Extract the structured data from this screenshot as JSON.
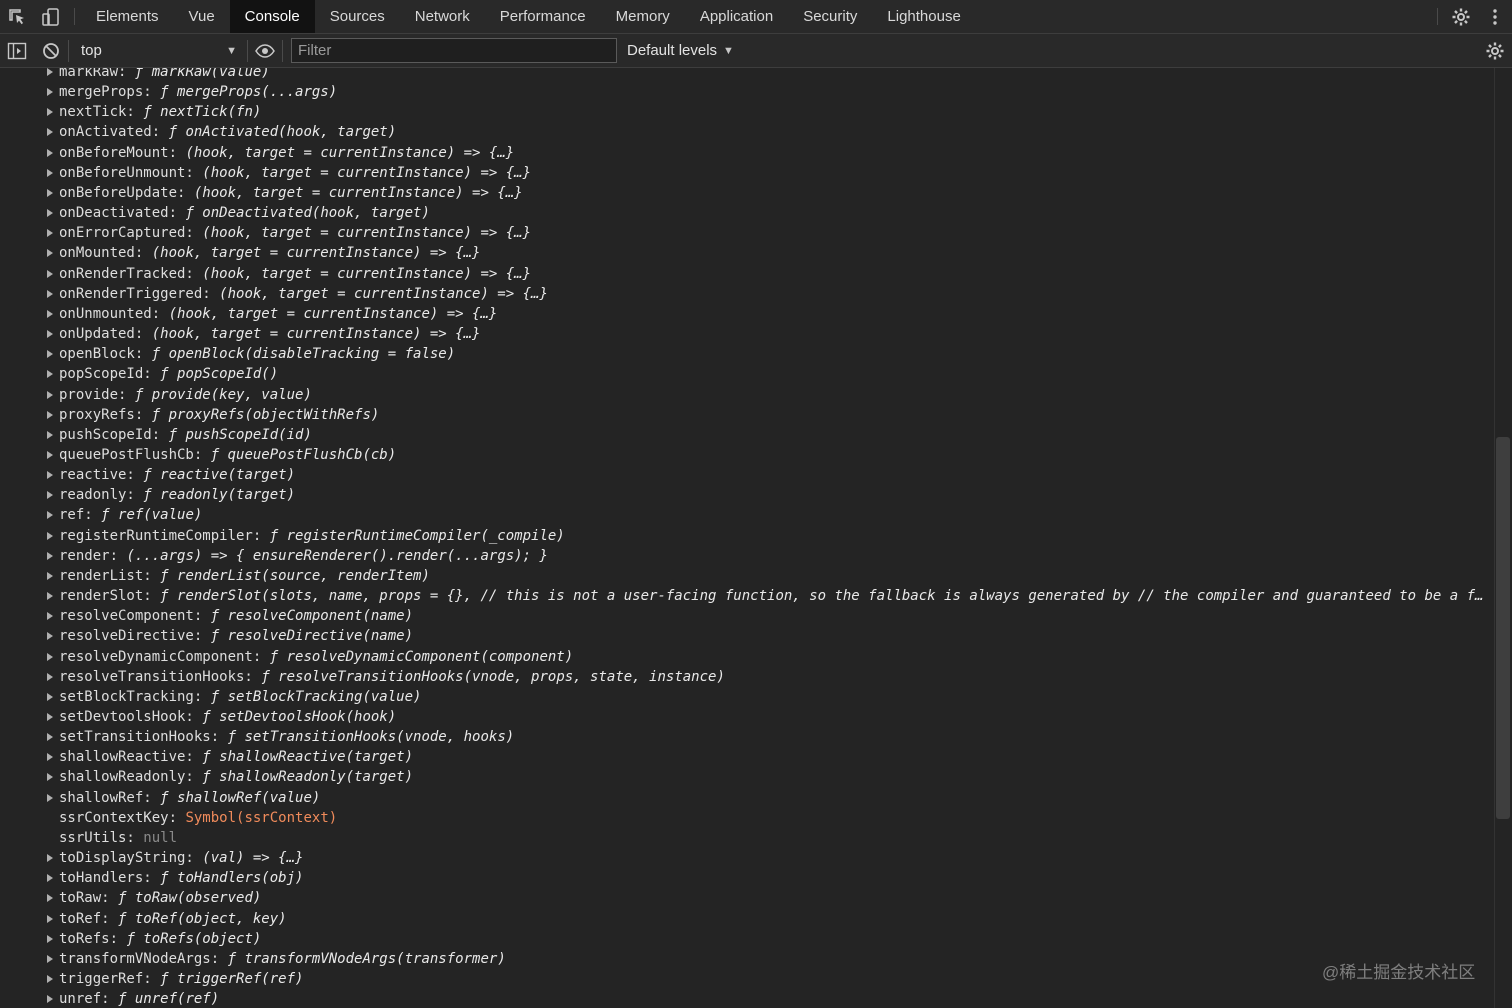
{
  "tabs": [
    {
      "label": "Elements"
    },
    {
      "label": "Vue"
    },
    {
      "label": "Console"
    },
    {
      "label": "Sources"
    },
    {
      "label": "Network"
    },
    {
      "label": "Performance"
    },
    {
      "label": "Memory"
    },
    {
      "label": "Application"
    },
    {
      "label": "Security"
    },
    {
      "label": "Lighthouse"
    }
  ],
  "active_tab": "Console",
  "toolbar": {
    "context": "top",
    "filter_placeholder": "Filter",
    "levels": "Default levels"
  },
  "icons": {
    "inspect": "inspect-element-icon",
    "device": "device-toolbar-icon",
    "settings": "gear-icon",
    "more": "kebab-menu-icon",
    "sidebar": "sidebar-toggle-icon",
    "clear": "clear-console-icon",
    "eye": "eye-icon"
  },
  "entries": [
    {
      "key": "markRaw:",
      "value": "ƒ markRaw(value)",
      "expandable": true,
      "kind": "fn"
    },
    {
      "key": "mergeProps:",
      "value": "ƒ mergeProps(...args)",
      "expandable": true,
      "kind": "fn"
    },
    {
      "key": "nextTick:",
      "value": "ƒ nextTick(fn)",
      "expandable": true,
      "kind": "fn"
    },
    {
      "key": "onActivated:",
      "value": "ƒ onActivated(hook, target)",
      "expandable": true,
      "kind": "fn"
    },
    {
      "key": "onBeforeMount:",
      "value": "(hook, target = currentInstance) => {…}",
      "expandable": true,
      "kind": "fn"
    },
    {
      "key": "onBeforeUnmount:",
      "value": "(hook, target = currentInstance) => {…}",
      "expandable": true,
      "kind": "fn"
    },
    {
      "key": "onBeforeUpdate:",
      "value": "(hook, target = currentInstance) => {…}",
      "expandable": true,
      "kind": "fn"
    },
    {
      "key": "onDeactivated:",
      "value": "ƒ onDeactivated(hook, target)",
      "expandable": true,
      "kind": "fn"
    },
    {
      "key": "onErrorCaptured:",
      "value": "(hook, target = currentInstance) => {…}",
      "expandable": true,
      "kind": "fn"
    },
    {
      "key": "onMounted:",
      "value": "(hook, target = currentInstance) => {…}",
      "expandable": true,
      "kind": "fn"
    },
    {
      "key": "onRenderTracked:",
      "value": "(hook, target = currentInstance) => {…}",
      "expandable": true,
      "kind": "fn"
    },
    {
      "key": "onRenderTriggered:",
      "value": "(hook, target = currentInstance) => {…}",
      "expandable": true,
      "kind": "fn"
    },
    {
      "key": "onUnmounted:",
      "value": "(hook, target = currentInstance) => {…}",
      "expandable": true,
      "kind": "fn"
    },
    {
      "key": "onUpdated:",
      "value": "(hook, target = currentInstance) => {…}",
      "expandable": true,
      "kind": "fn"
    },
    {
      "key": "openBlock:",
      "value": "ƒ openBlock(disableTracking = false)",
      "expandable": true,
      "kind": "fn"
    },
    {
      "key": "popScopeId:",
      "value": "ƒ popScopeId()",
      "expandable": true,
      "kind": "fn"
    },
    {
      "key": "provide:",
      "value": "ƒ provide(key, value)",
      "expandable": true,
      "kind": "fn"
    },
    {
      "key": "proxyRefs:",
      "value": "ƒ proxyRefs(objectWithRefs)",
      "expandable": true,
      "kind": "fn"
    },
    {
      "key": "pushScopeId:",
      "value": "ƒ pushScopeId(id)",
      "expandable": true,
      "kind": "fn"
    },
    {
      "key": "queuePostFlushCb:",
      "value": "ƒ queuePostFlushCb(cb)",
      "expandable": true,
      "kind": "fn"
    },
    {
      "key": "reactive:",
      "value": "ƒ reactive(target)",
      "expandable": true,
      "kind": "fn"
    },
    {
      "key": "readonly:",
      "value": "ƒ readonly(target)",
      "expandable": true,
      "kind": "fn"
    },
    {
      "key": "ref:",
      "value": "ƒ ref(value)",
      "expandable": true,
      "kind": "fn"
    },
    {
      "key": "registerRuntimeCompiler:",
      "value": "ƒ registerRuntimeCompiler(_compile)",
      "expandable": true,
      "kind": "fn"
    },
    {
      "key": "render:",
      "value": "(...args) => { ensureRenderer().render(...args); }",
      "expandable": true,
      "kind": "fn"
    },
    {
      "key": "renderList:",
      "value": "ƒ renderList(source, renderItem)",
      "expandable": true,
      "kind": "fn"
    },
    {
      "key": "renderSlot:",
      "value": "ƒ renderSlot(slots, name, props = {}, // this is not a user-facing function, so the fallback is always generated by // the compiler and guaranteed to be a f…",
      "expandable": true,
      "kind": "fn"
    },
    {
      "key": "resolveComponent:",
      "value": "ƒ resolveComponent(name)",
      "expandable": true,
      "kind": "fn"
    },
    {
      "key": "resolveDirective:",
      "value": "ƒ resolveDirective(name)",
      "expandable": true,
      "kind": "fn"
    },
    {
      "key": "resolveDynamicComponent:",
      "value": "ƒ resolveDynamicComponent(component)",
      "expandable": true,
      "kind": "fn"
    },
    {
      "key": "resolveTransitionHooks:",
      "value": "ƒ resolveTransitionHooks(vnode, props, state, instance)",
      "expandable": true,
      "kind": "fn"
    },
    {
      "key": "setBlockTracking:",
      "value": "ƒ setBlockTracking(value)",
      "expandable": true,
      "kind": "fn"
    },
    {
      "key": "setDevtoolsHook:",
      "value": "ƒ setDevtoolsHook(hook)",
      "expandable": true,
      "kind": "fn"
    },
    {
      "key": "setTransitionHooks:",
      "value": "ƒ setTransitionHooks(vnode, hooks)",
      "expandable": true,
      "kind": "fn"
    },
    {
      "key": "shallowReactive:",
      "value": "ƒ shallowReactive(target)",
      "expandable": true,
      "kind": "fn"
    },
    {
      "key": "shallowReadonly:",
      "value": "ƒ shallowReadonly(target)",
      "expandable": true,
      "kind": "fn"
    },
    {
      "key": "shallowRef:",
      "value": "ƒ shallowRef(value)",
      "expandable": true,
      "kind": "fn"
    },
    {
      "key": "ssrContextKey:",
      "value": "Symbol(ssrContext)",
      "expandable": false,
      "kind": "sym"
    },
    {
      "key": "ssrUtils:",
      "value": "null",
      "expandable": false,
      "kind": "nul"
    },
    {
      "key": "toDisplayString:",
      "value": "(val) => {…}",
      "expandable": true,
      "kind": "fn"
    },
    {
      "key": "toHandlers:",
      "value": "ƒ toHandlers(obj)",
      "expandable": true,
      "kind": "fn"
    },
    {
      "key": "toRaw:",
      "value": "ƒ toRaw(observed)",
      "expandable": true,
      "kind": "fn"
    },
    {
      "key": "toRef:",
      "value": "ƒ toRef(object, key)",
      "expandable": true,
      "kind": "fn"
    },
    {
      "key": "toRefs:",
      "value": "ƒ toRefs(object)",
      "expandable": true,
      "kind": "fn"
    },
    {
      "key": "transformVNodeArgs:",
      "value": "ƒ transformVNodeArgs(transformer)",
      "expandable": true,
      "kind": "fn"
    },
    {
      "key": "triggerRef:",
      "value": "ƒ triggerRef(ref)",
      "expandable": true,
      "kind": "fn"
    },
    {
      "key": "unref:",
      "value": "ƒ unref(ref)",
      "expandable": true,
      "kind": "fn"
    }
  ],
  "watermark": "@稀土掘金技术社区"
}
